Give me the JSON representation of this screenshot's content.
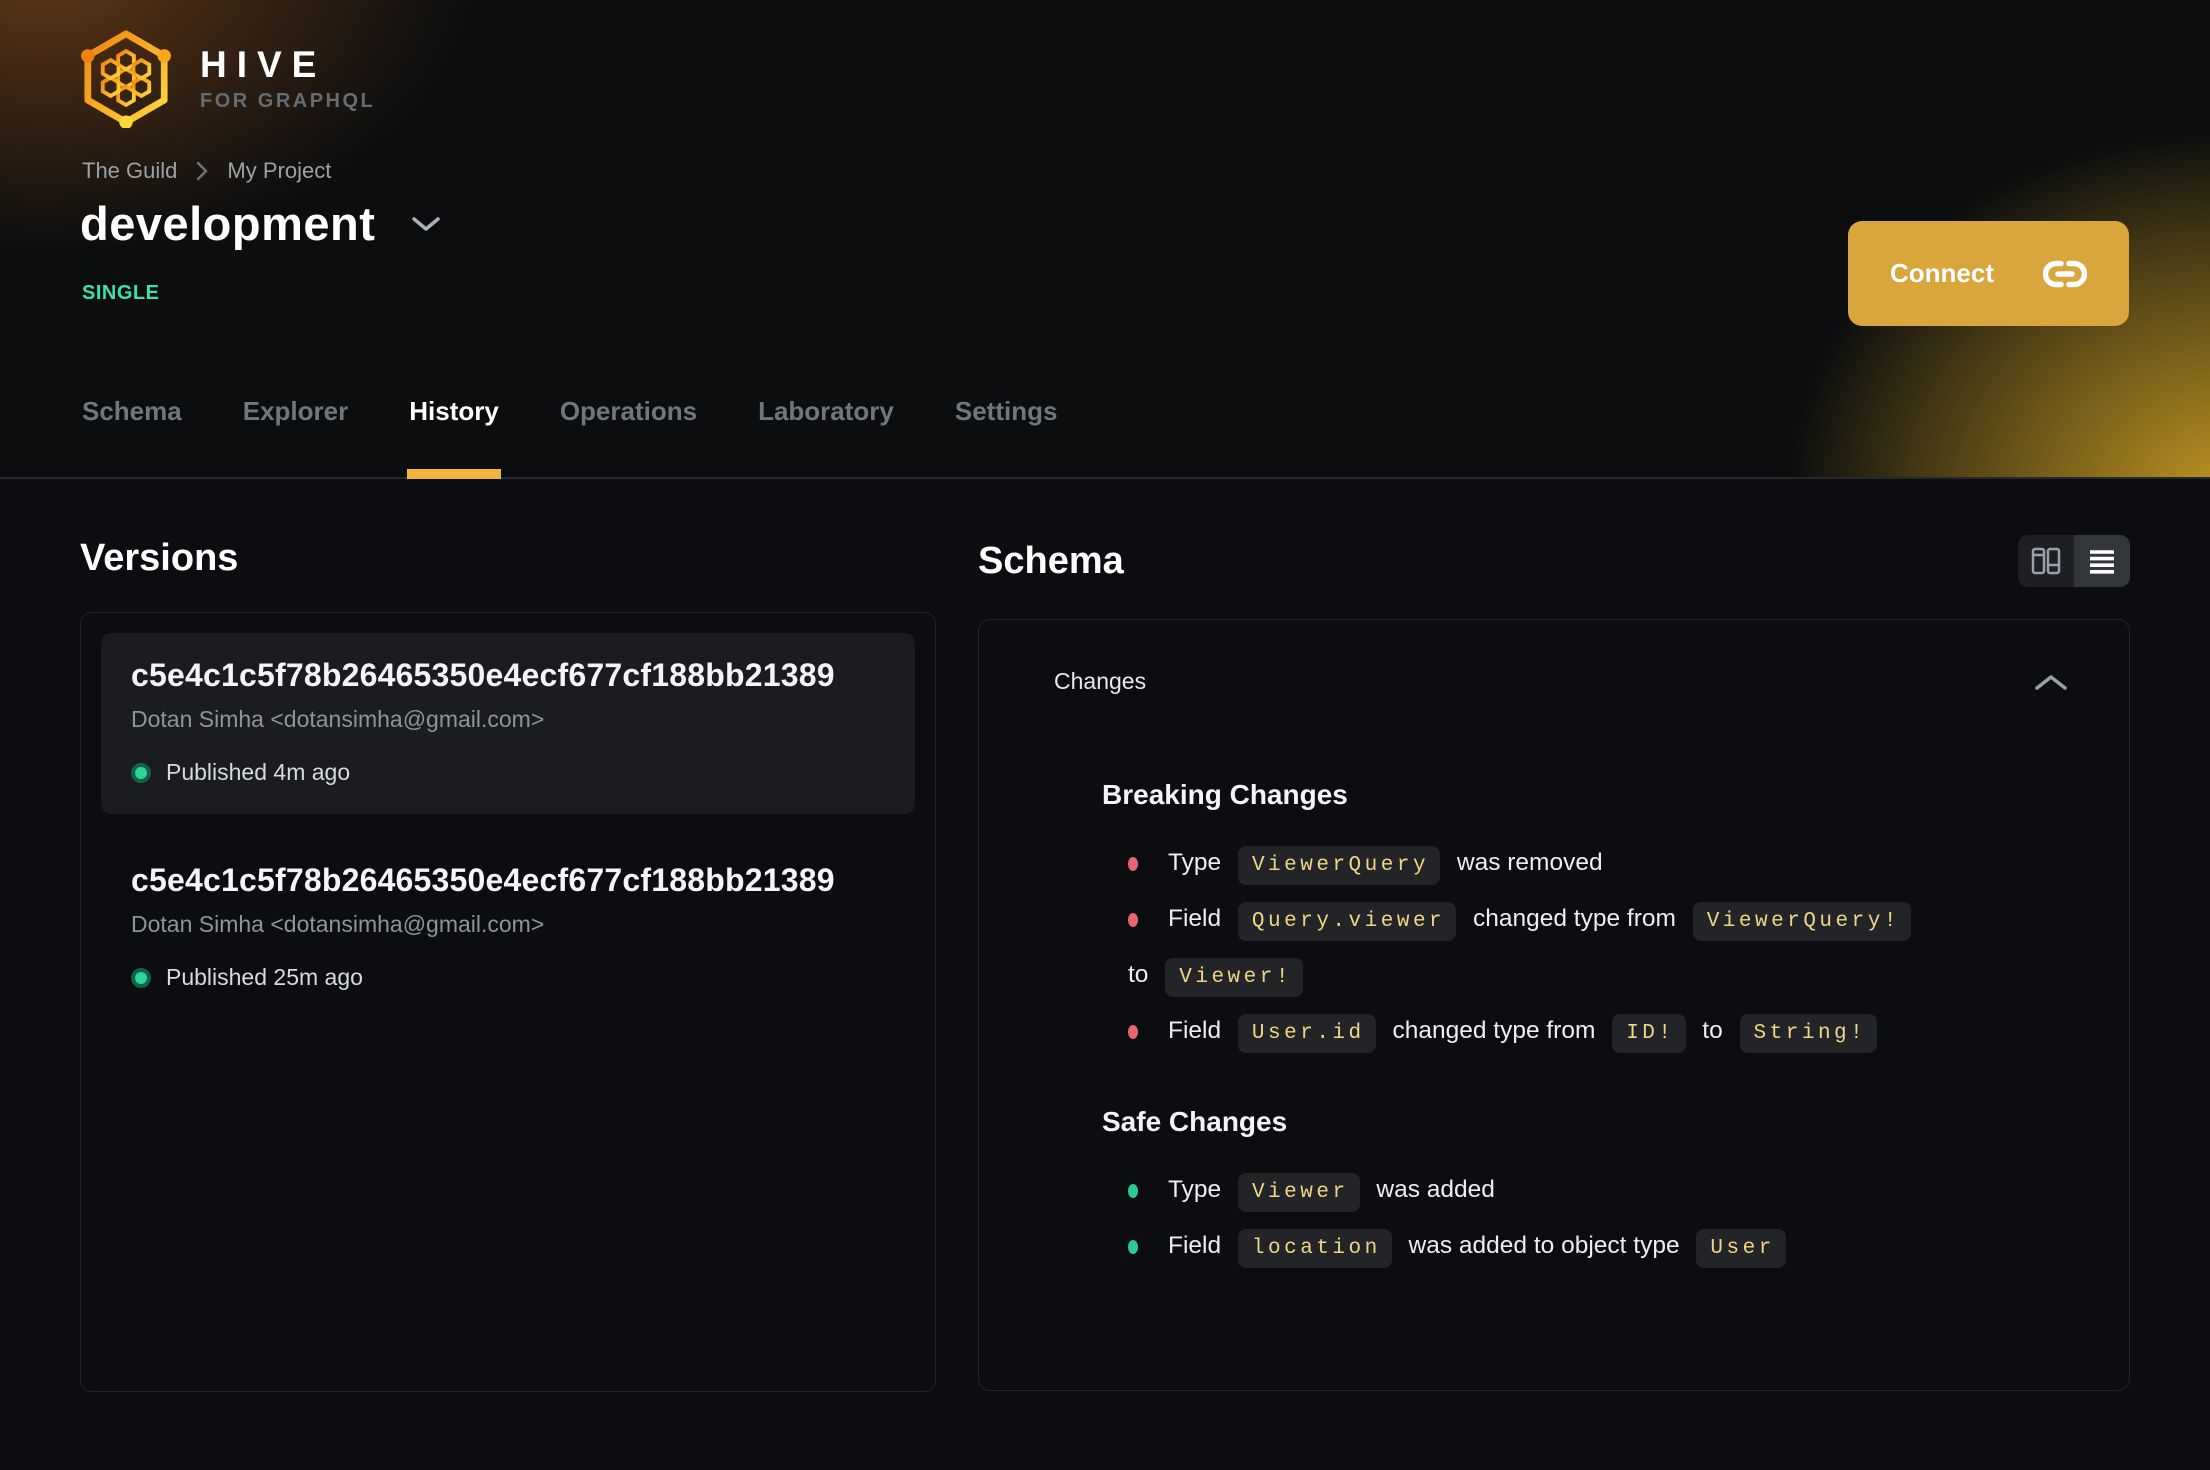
{
  "brand": {
    "name": "HIVE",
    "tagline": "FOR GRAPHQL",
    "logo_icon": "hive-honeycomb-icon"
  },
  "breadcrumb": {
    "items": [
      "The Guild",
      "My Project"
    ],
    "separator_icon": "chevron-right-icon"
  },
  "target": {
    "name": "development",
    "dropdown_icon": "chevron-down-icon",
    "badge": "SINGLE"
  },
  "connect_button": {
    "label": "Connect",
    "icon": "link-icon"
  },
  "tabs": [
    {
      "label": "Schema",
      "active": false
    },
    {
      "label": "Explorer",
      "active": false
    },
    {
      "label": "History",
      "active": true
    },
    {
      "label": "Operations",
      "active": false
    },
    {
      "label": "Laboratory",
      "active": false
    },
    {
      "label": "Settings",
      "active": false
    }
  ],
  "versions": {
    "heading": "Versions",
    "items": [
      {
        "hash": "c5e4c1c5f78b26465350e4ecf677cf188bb21389",
        "author": "Dotan Simha <dotansimha@gmail.com>",
        "status": "Published 4m ago",
        "active": true
      },
      {
        "hash": "c5e4c1c5f78b26465350e4ecf677cf188bb21389",
        "author": "Dotan Simha <dotansimha@gmail.com>",
        "status": "Published 25m ago",
        "active": false
      }
    ]
  },
  "schema_view": {
    "heading": "Schema",
    "view_toggle": [
      {
        "icon": "columns-view-icon",
        "selected": false
      },
      {
        "icon": "list-view-icon",
        "selected": true
      }
    ],
    "changes_label": "Changes",
    "collapse_icon": "chevron-up-icon",
    "sections": [
      {
        "title": "Breaking Changes",
        "kind": "breaking",
        "items": [
          [
            {
              "text": "Type "
            },
            {
              "code": "ViewerQuery"
            },
            {
              "text": " was removed"
            }
          ],
          [
            {
              "text": "Field "
            },
            {
              "code": "Query.viewer"
            },
            {
              "text": " changed type from "
            },
            {
              "code": "ViewerQuery!"
            },
            {
              "wrap": true
            },
            {
              "text": "to "
            },
            {
              "code": "Viewer!"
            }
          ],
          [
            {
              "text": "Field "
            },
            {
              "code": "User.id"
            },
            {
              "text": " changed type from "
            },
            {
              "code": "ID!"
            },
            {
              "text": " to "
            },
            {
              "code": "String!"
            }
          ]
        ]
      },
      {
        "title": "Safe Changes",
        "kind": "safe",
        "items": [
          [
            {
              "text": "Type "
            },
            {
              "code": "Viewer"
            },
            {
              "text": " was added"
            }
          ],
          [
            {
              "text": "Field "
            },
            {
              "code": "location"
            },
            {
              "text": " was added to object type "
            },
            {
              "code": "User"
            }
          ]
        ]
      }
    ]
  },
  "colors": {
    "page_bg": "#0b0d10",
    "accent": "#d9a63e",
    "accent_bright": "#f2b43c",
    "badge_green": "#3ce0ac",
    "dot_green": "#2fd596",
    "dot_ring": "#14604b",
    "bullet_red": "#e5646f",
    "bullet_green": "#2dca95",
    "chip_bg": "#222428",
    "chip_text": "#f0d585",
    "panel_border": "#212429",
    "card_bg": "#1a1c1f",
    "text_muted": "#8d949c",
    "tab_inactive": "#70767f"
  }
}
